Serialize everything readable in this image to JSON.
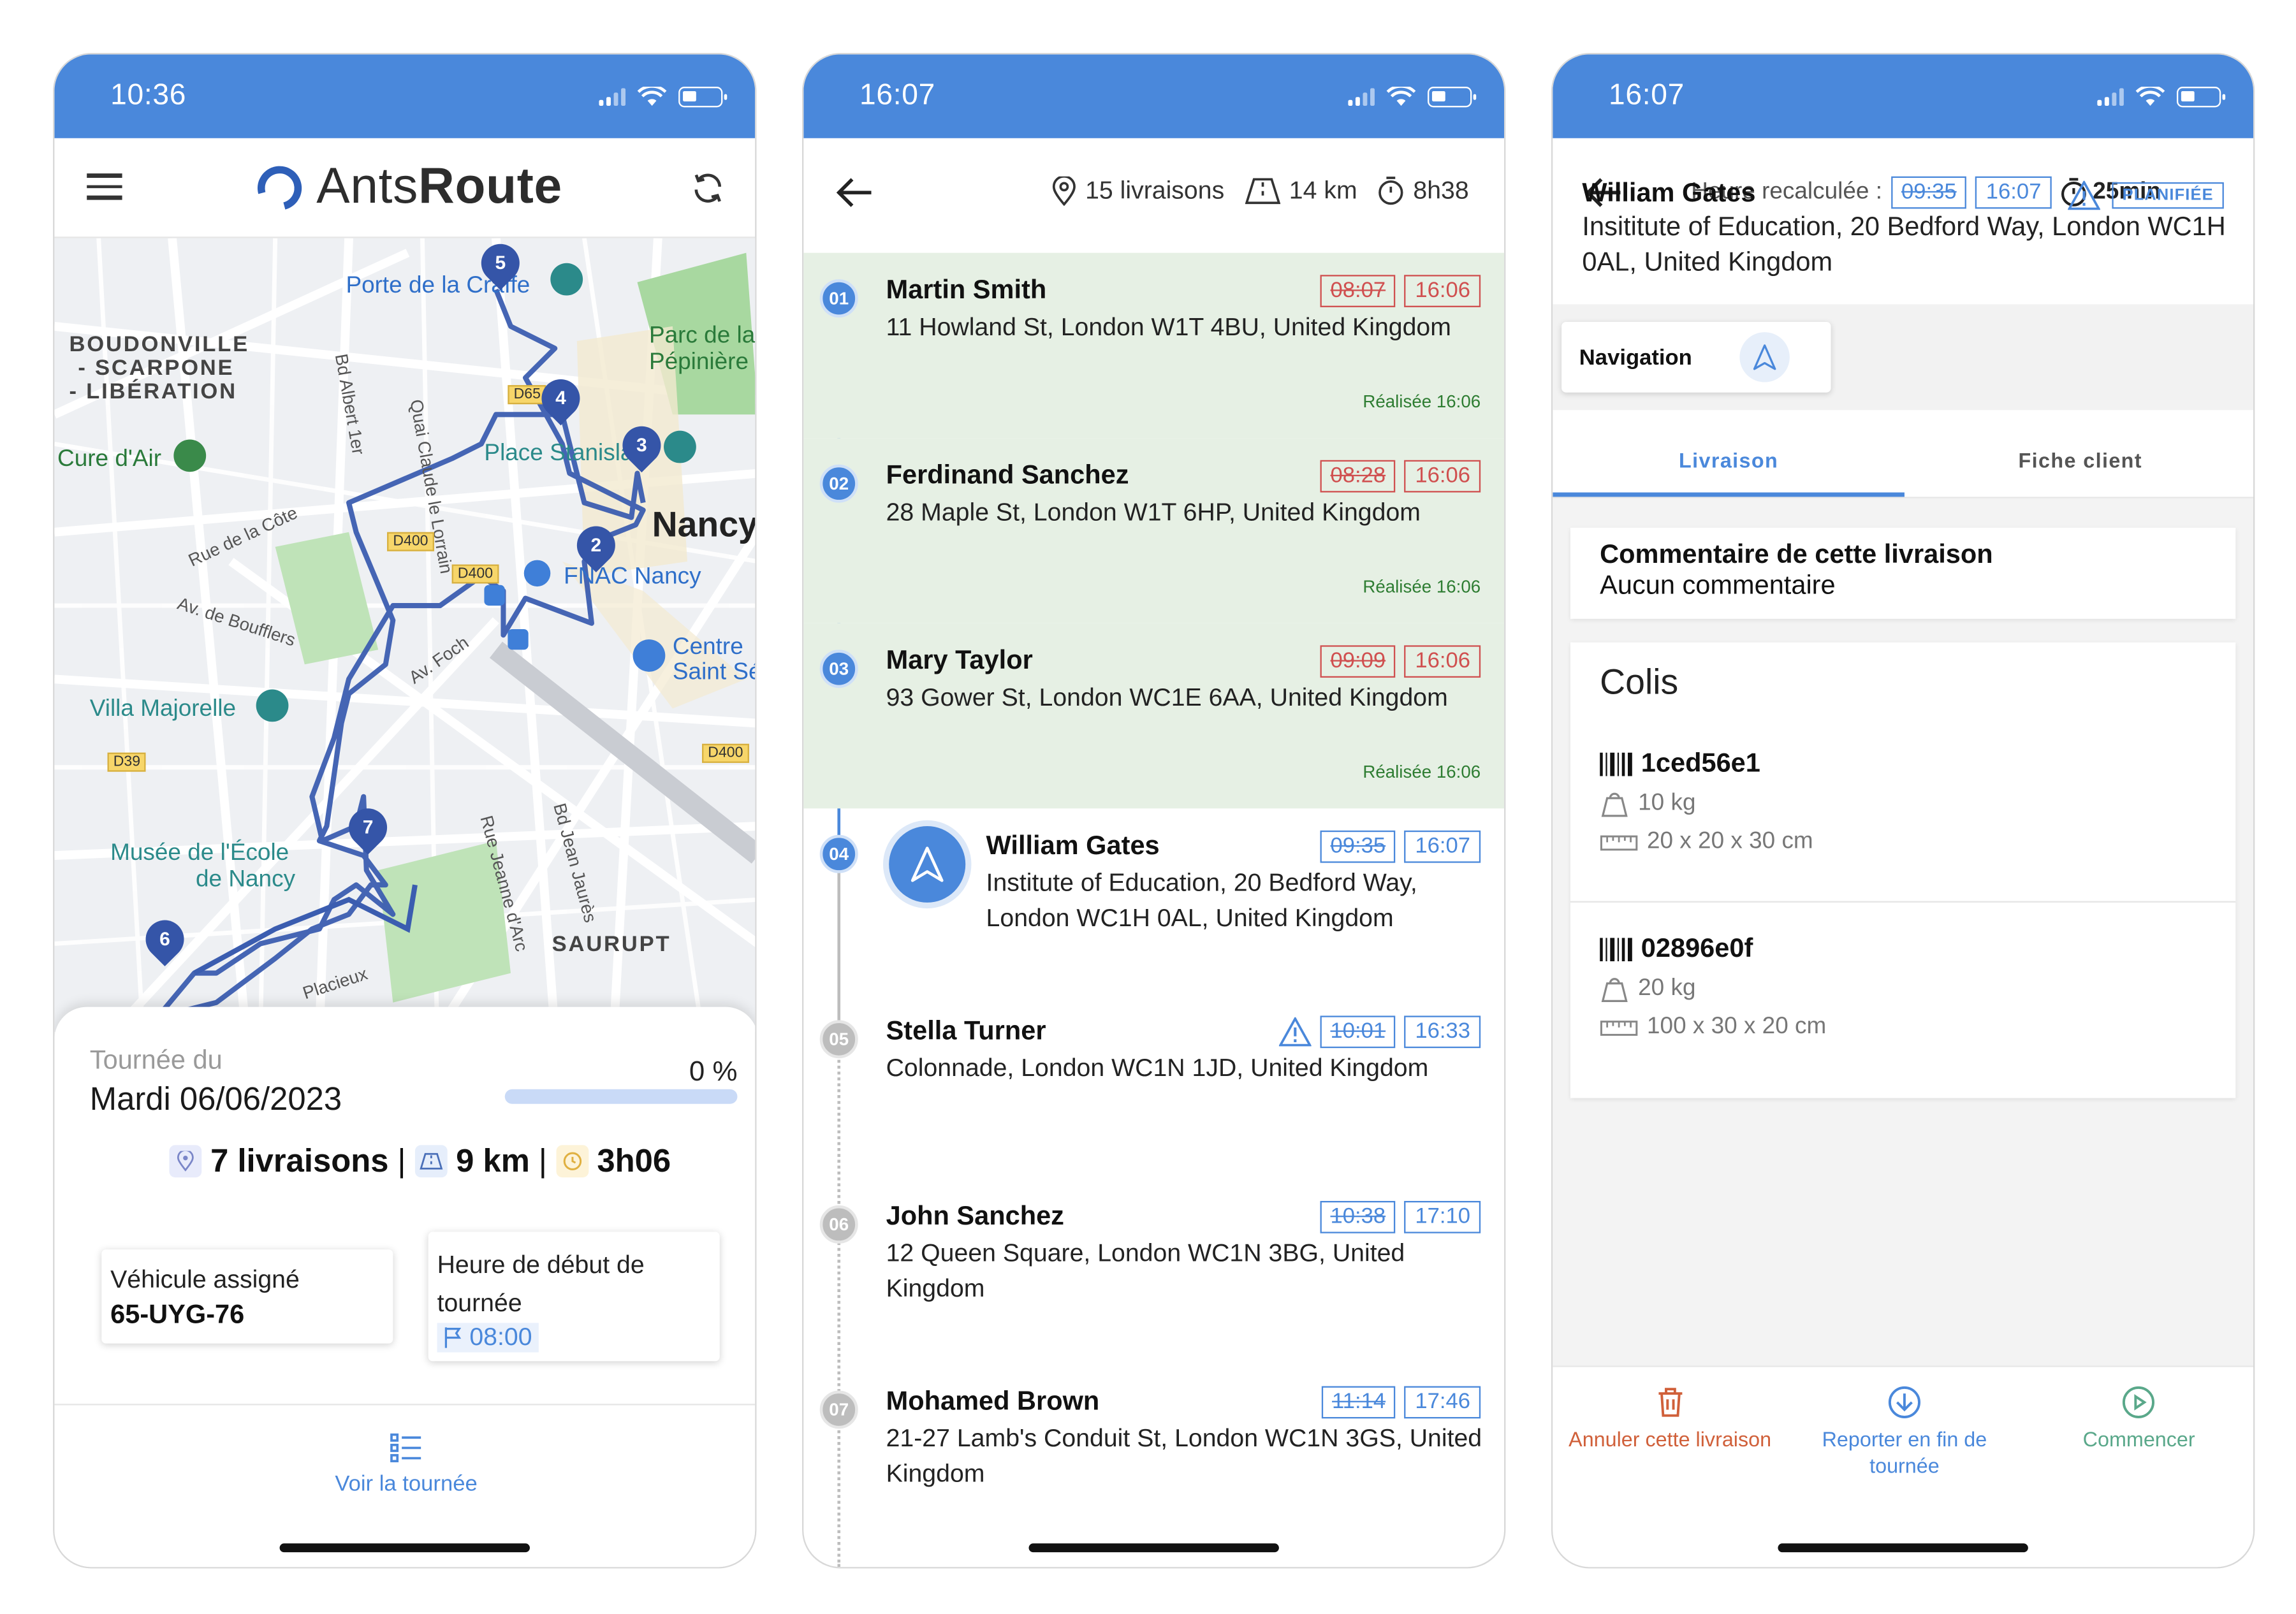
{
  "phone1": {
    "status_time": "10:36",
    "brand": {
      "part1": "Ants",
      "part2": "Route"
    },
    "map": {
      "labels": {
        "porte": "Porte de la Craffe",
        "boudon1": "BOUDONVILLE",
        "boudon2": "- SCARPONE",
        "boudon3": "- LIBÉRATION",
        "cure": "Cure d'Air",
        "parc1": "Parc de la",
        "parc2": "Pépinière",
        "place": "Place Stanislas",
        "nancy": "Nancy",
        "fnac": "FNAC Nancy",
        "centre1": "Centre",
        "centre2": "Saint Sébastien",
        "villa": "Villa Majorelle",
        "musee1": "Musée de l'École",
        "musee2": "de Nancy",
        "saurupt": "SAURUPT",
        "rue_cote": "Rue de la Côte",
        "av_boufflers": "Av. de Boufflers",
        "bd_albert": "Bd Albert 1er",
        "quai": "Quai Claude le Lorrain",
        "jeanne": "Rue Jeanne d'Arc",
        "jean_jaures": "Bd Jean Jaurès",
        "foch": "Av. Foch",
        "placieux": "Placieux",
        "d400a": "D400",
        "d400b": "D400",
        "d400c": "D400",
        "d39": "D39",
        "d65": "D65"
      },
      "pins": [
        "5",
        "4",
        "3",
        "2",
        "7",
        "6"
      ]
    },
    "tour_label": "Tournée du",
    "tour_date": "Mardi 06/06/2023",
    "progress_text": "0 %",
    "progress_value": 0,
    "stats": {
      "deliveries": "7 livraisons",
      "sep1": "|",
      "distance": "9 km",
      "sep2": "|",
      "duration": "3h06"
    },
    "vehicle_label": "Véhicule assigné",
    "vehicle_value": "65-UYG-76",
    "start_label": "Heure de début de tournée",
    "start_value": "08:00",
    "voir_label": "Voir la tournée"
  },
  "phone2": {
    "status_time": "16:07",
    "meta": {
      "deliveries": "15 livraisons",
      "distance": "14 km",
      "duration": "8h38"
    },
    "stops": [
      {
        "num": "01",
        "name": "Martin Smith",
        "address": "11 Howland St, London W1T 4BU, United Kingdom",
        "planned": "08:07",
        "actual": "16:06",
        "status": "Réalisée 16:06"
      },
      {
        "num": "02",
        "name": "Ferdinand Sanchez",
        "address": "28 Maple St, London W1T 6HP, United Kingdom",
        "planned": "08:28",
        "actual": "16:06",
        "status": "Réalisée 16:06"
      },
      {
        "num": "03",
        "name": "Mary Taylor",
        "address": "93 Gower St, London WC1E 6AA, United Kingdom",
        "planned": "09:09",
        "actual": "16:06",
        "status": "Réalisée 16:06"
      },
      {
        "num": "04",
        "name": "William Gates",
        "address": "Institute of Education, 20 Bedford Way, London WC1H 0AL, United Kingdom",
        "planned": "09:35",
        "actual": "16:07"
      },
      {
        "num": "05",
        "name": "Stella Turner",
        "address": "Colonnade, London WC1N 1JD, United Kingdom",
        "planned": "10:01",
        "actual": "16:33"
      },
      {
        "num": "06",
        "name": "John Sanchez",
        "address": "12 Queen Square, London WC1N 3BG, United Kingdom",
        "planned": "10:38",
        "actual": "17:10"
      },
      {
        "num": "07",
        "name": "Mohamed Brown",
        "address": "21-27 Lamb's Conduit St, London WC1N 3GS, United Kingdom",
        "planned": "11:14",
        "actual": "17:46"
      }
    ]
  },
  "phone3": {
    "status_time": "16:07",
    "recalc_label": "Heure recalculée :",
    "planned": "09:35",
    "actual": "16:07",
    "delay": "25min",
    "customer_name": "William Gates",
    "customer_address": "Insititute of Education, 20 Bedford Way, London WC1H 0AL, United Kingdom",
    "status_tag": "PLANIFIÉE",
    "navigation_label": "Navigation",
    "tabs": [
      "Livraison",
      "Fiche client"
    ],
    "comment_title": "Commentaire de cette livraison",
    "comment_value": "Aucun commentaire",
    "colis_title": "Colis",
    "packages": [
      {
        "id": "1ced56e1",
        "weight": "10 kg",
        "dims": "20 x 20 x 30 cm"
      },
      {
        "id": "02896e0f",
        "weight": "20 kg",
        "dims": "100 x 30 x 20 cm"
      }
    ],
    "actions": {
      "cancel": "Annuler cette livraison",
      "postpone": "Reporter en fin de tournée",
      "start": "Commencer"
    }
  },
  "colors": {
    "primary": "#4a88db",
    "route": "#3555a8",
    "done_bg": "#e6f0e4",
    "late": "#d05050"
  }
}
